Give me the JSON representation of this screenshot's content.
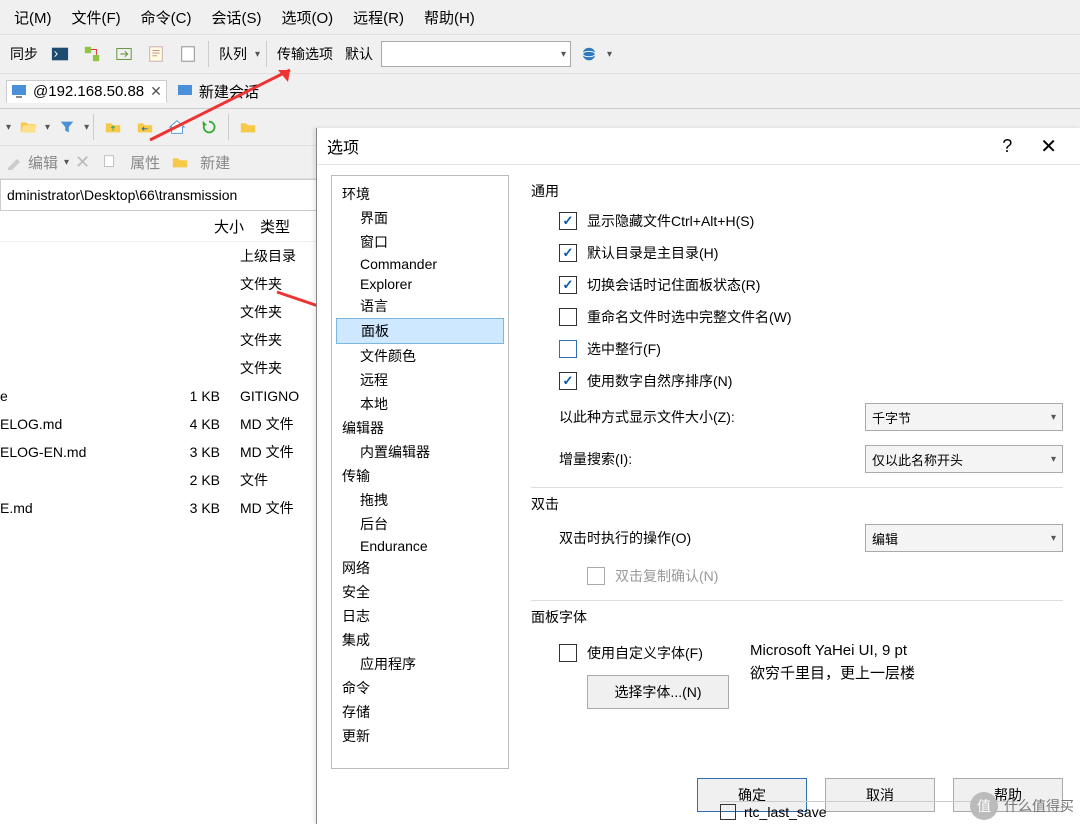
{
  "menubar": [
    "记(M)",
    "文件(F)",
    "命令(C)",
    "会话(S)",
    "选项(O)",
    "远程(R)",
    "帮助(H)"
  ],
  "toolbar": {
    "sync": "同步",
    "queue": "队列",
    "transfer_opts": "传输选项",
    "transfer_default": "默认"
  },
  "tabs": {
    "t1": "@192.168.50.88",
    "t2": "新建会话"
  },
  "editbar": {
    "edit": "编辑",
    "props": "属性",
    "new": "新建"
  },
  "path": "dministrator\\Desktop\\66\\transmission",
  "file_head": {
    "size": "大小",
    "type": "类型"
  },
  "files": [
    {
      "name": "",
      "size": "",
      "type": "上级目录"
    },
    {
      "name": "",
      "size": "",
      "type": "文件夹"
    },
    {
      "name": "",
      "size": "",
      "type": "文件夹"
    },
    {
      "name": "",
      "size": "",
      "type": "文件夹"
    },
    {
      "name": "",
      "size": "",
      "type": "文件夹"
    },
    {
      "name": "e",
      "size": "1 KB",
      "type": "GITIGNO"
    },
    {
      "name": "ELOG.md",
      "size": "4 KB",
      "type": "MD 文件"
    },
    {
      "name": "ELOG-EN.md",
      "size": "3 KB",
      "type": "MD 文件"
    },
    {
      "name": "",
      "size": "2 KB",
      "type": "文件"
    },
    {
      "name": "E.md",
      "size": "3 KB",
      "type": "MD 文件"
    }
  ],
  "dialog": {
    "title": "选项",
    "tree": [
      {
        "l": 0,
        "t": "环境"
      },
      {
        "l": 1,
        "t": "界面"
      },
      {
        "l": 1,
        "t": "窗口"
      },
      {
        "l": 1,
        "t": "Commander"
      },
      {
        "l": 1,
        "t": "Explorer"
      },
      {
        "l": 1,
        "t": "语言"
      },
      {
        "l": 0,
        "t": "面板",
        "sel": true
      },
      {
        "l": 1,
        "t": "文件颜色"
      },
      {
        "l": 1,
        "t": "远程"
      },
      {
        "l": 1,
        "t": "本地"
      },
      {
        "l": 0,
        "t": "编辑器"
      },
      {
        "l": 1,
        "t": "内置编辑器"
      },
      {
        "l": 0,
        "t": "传输"
      },
      {
        "l": 1,
        "t": "拖拽"
      },
      {
        "l": 1,
        "t": "后台"
      },
      {
        "l": 1,
        "t": "Endurance"
      },
      {
        "l": 0,
        "t": "网络"
      },
      {
        "l": 0,
        "t": "安全"
      },
      {
        "l": 0,
        "t": "日志"
      },
      {
        "l": 0,
        "t": "集成"
      },
      {
        "l": 1,
        "t": "应用程序"
      },
      {
        "l": 0,
        "t": "命令"
      },
      {
        "l": 0,
        "t": "存储"
      },
      {
        "l": 0,
        "t": "更新"
      }
    ],
    "g_general": "通用",
    "cb1": "显示隐藏文件Ctrl+Alt+H(S)",
    "cb2": "默认目录是主目录(H)",
    "cb3": "切换会话时记住面板状态(R)",
    "cb4": "重命名文件时选中完整文件名(W)",
    "cb5": "选中整行(F)",
    "cb6": "使用数字自然序排序(N)",
    "size_lbl": "以此种方式显示文件大小(Z):",
    "size_val": "千字节",
    "inc_lbl": "增量搜索(I):",
    "inc_val": "仅以此名称开头",
    "g_dbl": "双击",
    "dbl_lbl": "双击时执行的操作(O)",
    "dbl_val": "编辑",
    "dbl_confirm": "双击复制确认(N)",
    "g_font": "面板字体",
    "cb_font": "使用自定义字体(F)",
    "font_sample1": "Microsoft YaHei UI, 9 pt",
    "font_sample2": "欲穷千里目，更上一层楼",
    "font_btn": "选择字体...(N)",
    "ok": "确定",
    "cancel": "取消",
    "help": "帮助"
  },
  "rtc": "rtc_last_save",
  "watermark": {
    "badge": "值",
    "text": "什么值得买"
  }
}
